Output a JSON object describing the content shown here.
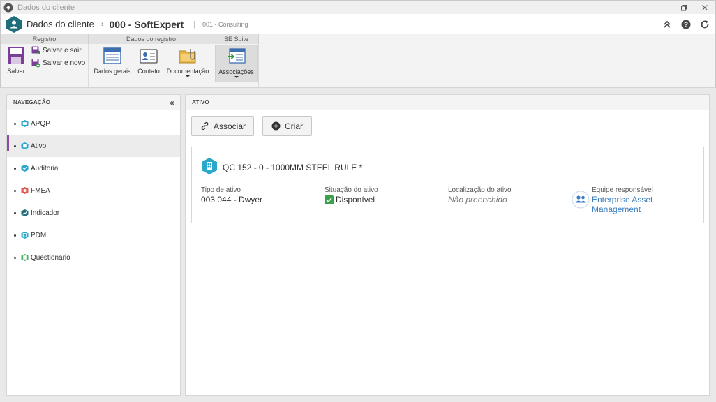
{
  "window": {
    "title": "Dados do cliente",
    "controls": [
      "minimize-icon",
      "restore-icon",
      "close-icon"
    ]
  },
  "header": {
    "breadcrumb_root": "Dados do cliente",
    "breadcrumb_separator": "›",
    "record_title": "000 - SoftExpert",
    "divider": "|",
    "record_subtitle": "001 - Consulting",
    "actions": [
      "collapse-up-icon",
      "help-icon",
      "refresh-icon"
    ]
  },
  "ribbon": {
    "groups": [
      {
        "title": "Registro",
        "buttons": [
          {
            "label": "Salvar",
            "icon": "save-icon"
          },
          {
            "label": "Salvar e sair",
            "icon": "save-exit-icon"
          },
          {
            "label": "Salvar e novo",
            "icon": "save-new-icon"
          }
        ]
      },
      {
        "title": "Dados do registro",
        "buttons": [
          {
            "label": "Dados gerais",
            "icon": "general-data-icon"
          },
          {
            "label": "Contato",
            "icon": "contact-card-icon"
          },
          {
            "label": "Documentação",
            "icon": "folder-attachment-icon"
          }
        ]
      },
      {
        "title": "SE Suite",
        "buttons": [
          {
            "label": "Associações",
            "icon": "associations-icon"
          }
        ]
      }
    ]
  },
  "navigation": {
    "title": "NAVEGAÇÃO",
    "items": [
      {
        "label": "APQP",
        "icon": "apqp-icon",
        "color": "#2aa7c9"
      },
      {
        "label": "Ativo",
        "icon": "asset-icon",
        "color": "#2aa7c9",
        "selected": true
      },
      {
        "label": "Auditoria",
        "icon": "audit-icon",
        "color": "#2aa7c9"
      },
      {
        "label": "FMEA",
        "icon": "fmea-icon",
        "color": "#e05a4f"
      },
      {
        "label": "Indicador",
        "icon": "indicator-icon",
        "color": "#1f6e7a"
      },
      {
        "label": "PDM",
        "icon": "pdm-icon",
        "color": "#2aa7c9"
      },
      {
        "label": "Questionário",
        "icon": "questionnaire-icon",
        "color": "#4cae6a"
      }
    ]
  },
  "main": {
    "title": "ATIVO",
    "buttons": {
      "associate": "Associar",
      "create": "Criar"
    },
    "asset": {
      "title": "QC 152 - 0 - 1000MM STEEL RULE *",
      "fields": {
        "type_label": "Tipo de ativo",
        "type_value": "003.044 - Dwyer",
        "status_label": "Situação do ativo",
        "status_value": "Disponível",
        "location_label": "Localização do ativo",
        "location_value": "Não preenchido",
        "team_label": "Equipe responsável",
        "team_value_line1": "Enterprise Asset",
        "team_value_line2": "Management"
      }
    }
  },
  "colors": {
    "accent_purple": "#8a4fa3",
    "brand_teal": "#1f6e7a",
    "link_blue": "#3a7dc2",
    "status_green": "#3aa14a"
  }
}
